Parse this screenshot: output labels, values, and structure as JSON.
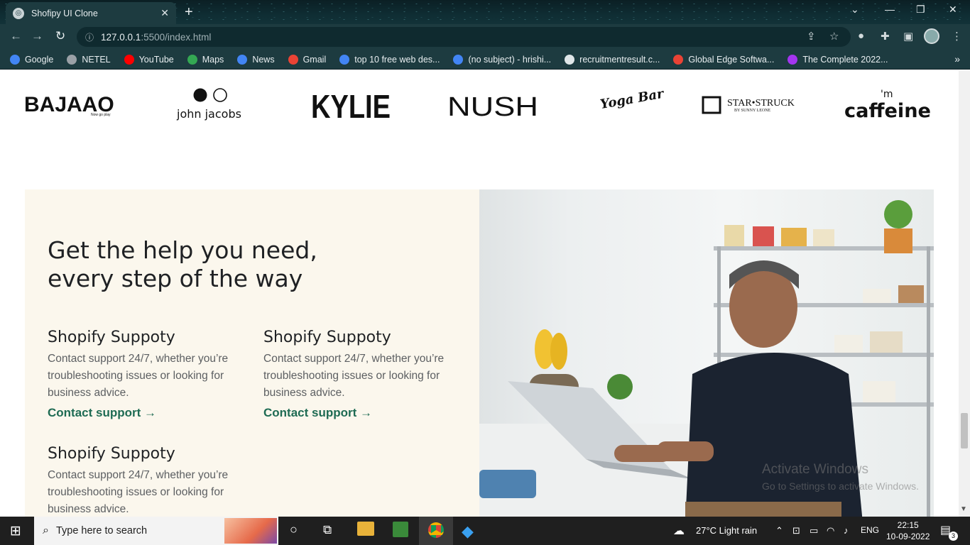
{
  "browser": {
    "tab_title": "Shofipy UI Clone",
    "tab_close": "✕",
    "new_tab": "+",
    "url_host": "127.0.0.1",
    "url_path": ":5500/index.html",
    "bookmarks": [
      {
        "label": "Google",
        "color": "#4285f4"
      },
      {
        "label": "NETEL",
        "color": "#9aa0a6"
      },
      {
        "label": "YouTube",
        "color": "#ff0000"
      },
      {
        "label": "Maps",
        "color": "#34a853"
      },
      {
        "label": "News",
        "color": "#4285f4"
      },
      {
        "label": "Gmail",
        "color": "#ea4335"
      },
      {
        "label": "top 10 free web des...",
        "color": "#4285f4"
      },
      {
        "label": "(no subject) - hrishi...",
        "color": "#4285f4"
      },
      {
        "label": "recruitmentresult.c...",
        "color": "#dfe6e8"
      },
      {
        "label": "Global Edge Softwa...",
        "color": "#ea4335"
      },
      {
        "label": "The Complete 2022...",
        "color": "#a435f0"
      }
    ]
  },
  "logos": [
    "BAJAAO",
    "john jacobs",
    "KYLIE",
    "NUSH",
    "Yoga Bar",
    "STAR•STRUCK",
    "caffeine"
  ],
  "logo_small": {
    "bajaao_tag": "Now go play",
    "starstruck_tag": "BY SUNNY LEONE",
    "mcaffeine_prefix": "'m"
  },
  "help": {
    "heading": "Get the help you need, every step of the way",
    "cards": [
      {
        "title": "Shopify Suppoty",
        "text": "Contact support 24/7, whether you’re troubleshooting issues or looking for business advice.",
        "link": "Contact support →"
      },
      {
        "title": "Shopify Suppoty",
        "text": "Contact support 24/7, whether you’re troubleshooting issues or looking for business advice.",
        "link": "Contact support →"
      },
      {
        "title": "Shopify Suppoty",
        "text": "Contact support 24/7, whether you’re troubleshooting issues or looking for business advice.",
        "link": ""
      }
    ]
  },
  "watermark": {
    "line1": "Activate Windows",
    "line2": "Go to Settings to activate Windows."
  },
  "taskbar": {
    "search_placeholder": "Type here to search",
    "weather": "27°C  Light rain",
    "lang": "ENG",
    "time": "22:15",
    "date": "10-09-2022",
    "notifications": "3"
  }
}
